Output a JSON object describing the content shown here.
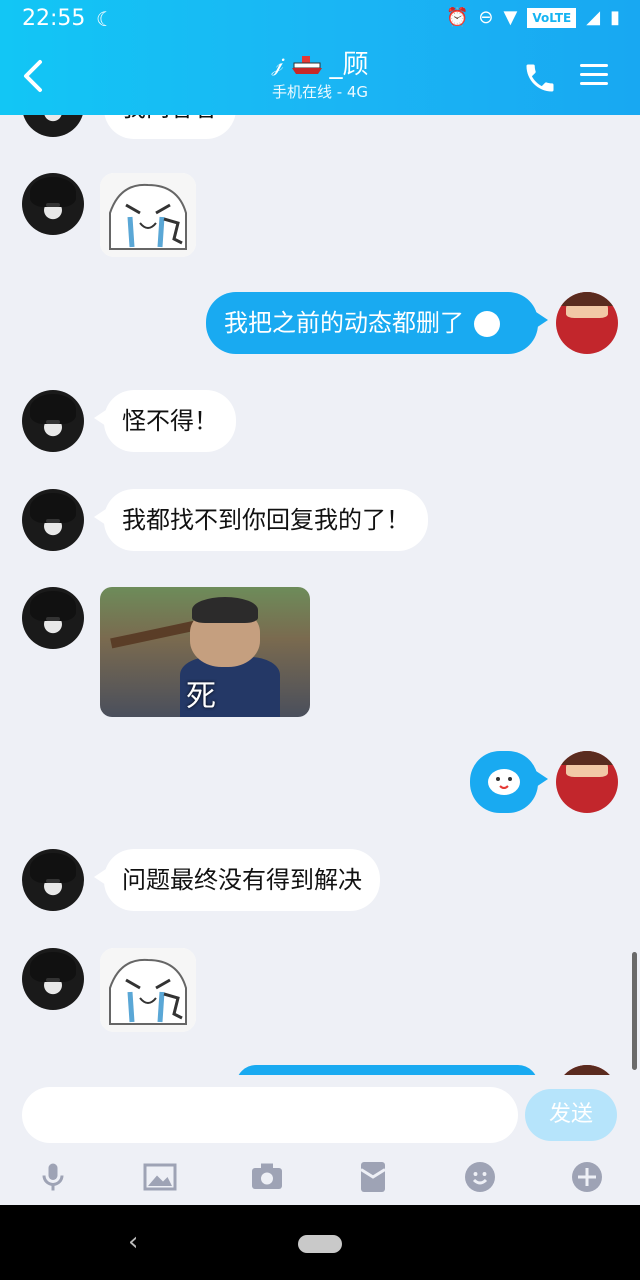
{
  "status_bar": {
    "time": "22:55",
    "volte": "VoLTE"
  },
  "header": {
    "title": "_顾",
    "subtitle": "手机在线 - 4G"
  },
  "messages": [
    {
      "side": "in",
      "type": "text",
      "text": "我问客客"
    },
    {
      "side": "in",
      "type": "sticker",
      "sticker": "crying-meme"
    },
    {
      "side": "out",
      "type": "text",
      "text": "我把之前的动态都删了"
    },
    {
      "side": "in",
      "type": "text",
      "text": "怪不得！"
    },
    {
      "side": "in",
      "type": "text",
      "text": "我都找不到你回复我的了！"
    },
    {
      "side": "in",
      "type": "sticker",
      "sticker": "photo-meme",
      "caption": "死"
    },
    {
      "side": "out",
      "type": "sticker",
      "sticker": "cute-face"
    },
    {
      "side": "in",
      "type": "text",
      "text": "问题最终没有得到解决"
    },
    {
      "side": "in",
      "type": "sticker",
      "sticker": "crying-meme"
    }
  ],
  "composer": {
    "placeholder": "",
    "send_label": "发送"
  },
  "toolbar": {
    "items": [
      "microphone-icon",
      "image-icon",
      "camera-icon",
      "red-packet-icon",
      "emoji-icon",
      "plus-icon"
    ]
  },
  "colors": {
    "header": "#1ab6f4",
    "outgoing_bubble": "#19aaf1",
    "background": "#eef0f6"
  }
}
